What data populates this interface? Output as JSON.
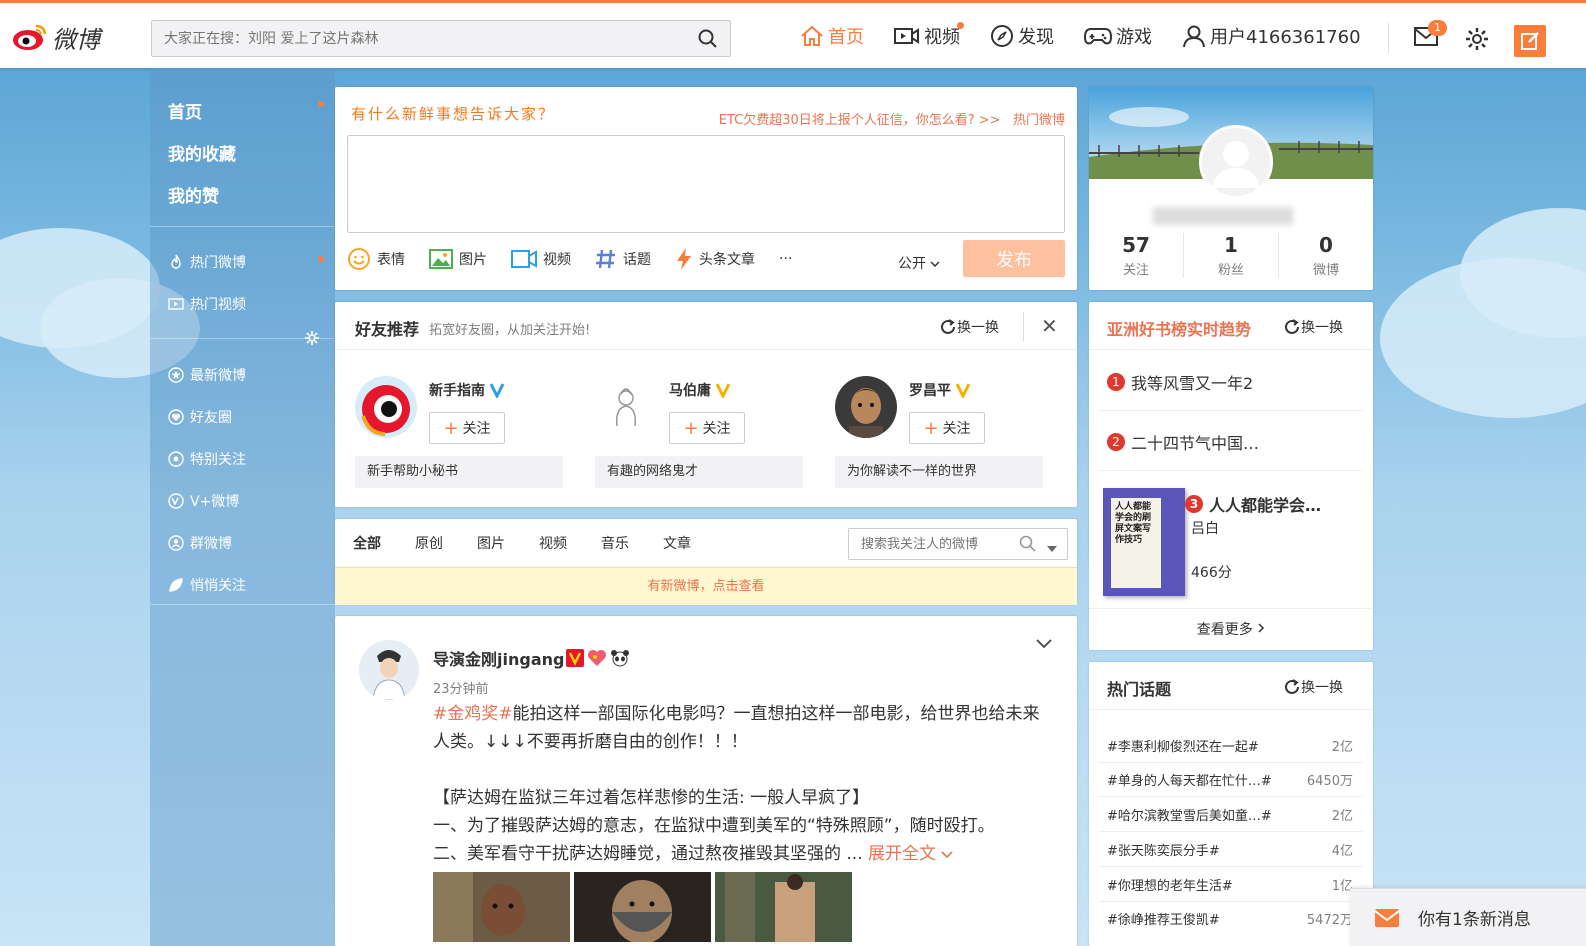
{
  "header": {
    "logo_text": "微博",
    "search_placeholder": "大家正在搜：刘阳 爱上了这片森林",
    "nav": [
      {
        "label": "首页",
        "icon": "home-icon",
        "active": true
      },
      {
        "label": "视频",
        "icon": "video-icon"
      },
      {
        "label": "发现",
        "icon": "compass-icon"
      },
      {
        "label": "游戏",
        "icon": "gamepad-icon"
      },
      {
        "label": "用户4166361760",
        "icon": "user-icon"
      }
    ],
    "mail_badge": "1"
  },
  "leftnav": {
    "top": [
      "首页",
      "我的收藏",
      "我的赞"
    ],
    "hot": [
      "热门微博",
      "热门视频"
    ],
    "groups": [
      "最新微博",
      "好友圈",
      "特别关注",
      "V+微博",
      "群微博",
      "悄悄关注"
    ]
  },
  "publisher": {
    "prompt": "有什么新鲜事想告诉大家？",
    "hot_link": "ETC欠费超30日将上报个人征信，你怎么看? >>",
    "hot_tag": "热门微博",
    "tools": [
      "表情",
      "图片",
      "视频",
      "话题",
      "头条文章",
      "···"
    ],
    "visibility": "公开",
    "submit": "发布"
  },
  "friend_rec": {
    "title": "好友推荐",
    "subtitle": "拓宽好友圈，从加关注开始!",
    "refresh": "换一换",
    "close": "✕",
    "follow_label": "关注",
    "friends": [
      {
        "name": "新手指南",
        "verify": "blue",
        "desc": "新手帮助小秘书"
      },
      {
        "name": "马伯庸",
        "verify": "gold",
        "desc": "有趣的网络鬼才"
      },
      {
        "name": "罗昌平",
        "verify": "gold",
        "desc": "为你解读不一样的世界"
      }
    ]
  },
  "feed": {
    "tabs": [
      "全部",
      "原创",
      "图片",
      "视频",
      "音乐",
      "文章"
    ],
    "search_placeholder": "搜索我关注人的微博",
    "new_notice": "有新微博，点击查看"
  },
  "post": {
    "author": "导演金刚jingang",
    "time": "23分钟前",
    "tag": "#金鸡奖#",
    "line1_rest": "能拍这样一部国际化电影吗？一直想拍这样一部电影，给世界也给未来人类。↓↓↓不要再折磨自由的创作！！！",
    "line2": "【萨达姆在监狱三年过着怎样悲惨的生活: 一般人早疯了】",
    "line3": "一、为了摧毁萨达姆的意志，在监狱中遭到美军的“特殊照顾”，随时殴打。",
    "line4": "二、美军看守干扰萨达姆睡觉，通过熬夜摧毁其坚强的 ...",
    "expand": "展开全文"
  },
  "profile": {
    "stats": [
      {
        "num": "57",
        "label": "关注"
      },
      {
        "num": "1",
        "label": "粉丝"
      },
      {
        "num": "0",
        "label": "微博"
      }
    ]
  },
  "books": {
    "title": "亚洲好书榜实时趋势",
    "refresh": "换一换",
    "items": [
      "我等风雪又一年2",
      "二十四节气中国…",
      "人人都能学会…"
    ],
    "author": "吕白",
    "score": "466分",
    "cover_text": "人人都能学会的刷屏文案写作技巧",
    "more": "查看更多"
  },
  "topics": {
    "title": "热门话题",
    "refresh": "换一换",
    "items": [
      {
        "name": "#李惠利柳俊烈还在一起#",
        "count": "2亿"
      },
      {
        "name": "#单身的人每天都在忙什…#",
        "count": "6450万"
      },
      {
        "name": "#哈尔滨教堂雪后美如童…#",
        "count": "2亿"
      },
      {
        "name": "#张天陈奕辰分手#",
        "count": "4亿"
      },
      {
        "name": "#你理想的老年生活#",
        "count": "1亿"
      },
      {
        "name": "#徐峥推荐王俊凯#",
        "count": "5472万"
      }
    ]
  },
  "toast": "你有1条新消息",
  "colors": {
    "accent": "#fa7d3c",
    "link": "#eb7350",
    "verify_blue": "#2d9fe8",
    "verify_gold": "#f5b000"
  }
}
